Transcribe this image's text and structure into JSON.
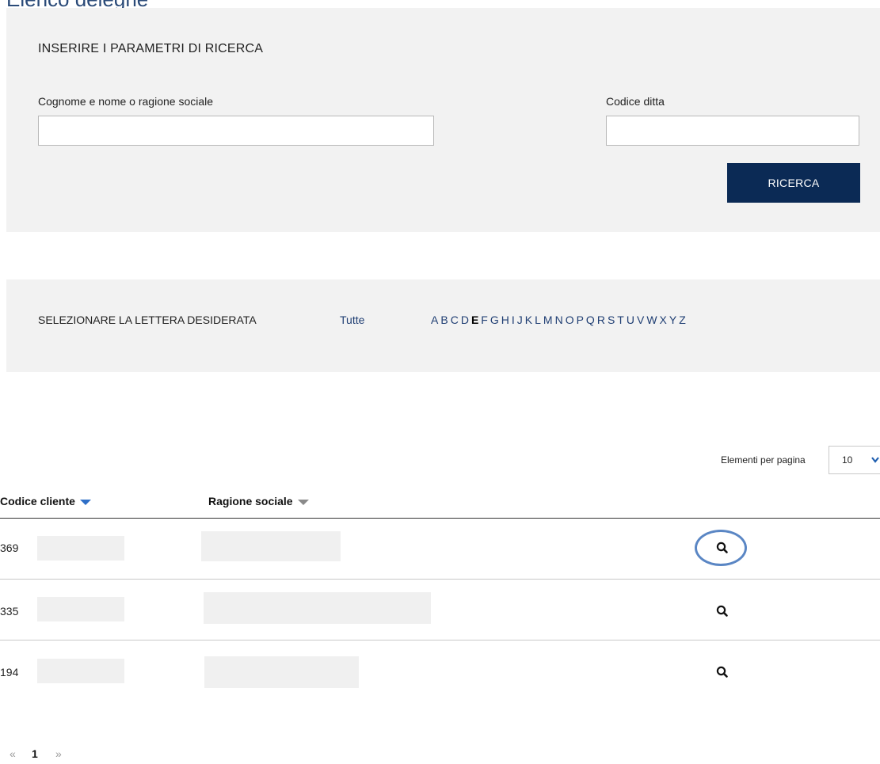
{
  "page": {
    "title": "Elenco deleghe"
  },
  "search": {
    "heading": "INSERIRE I PARAMETRI DI RICERCA",
    "name_label": "Cognome e nome o ragione sociale",
    "name_value": "",
    "code_label": "Codice ditta",
    "code_value": "",
    "button_label": "RICERCA"
  },
  "letter_filter": {
    "label": "SELEZIONARE LA LETTERA DESIDERATA",
    "all_label": "Tutte",
    "letters": [
      "A",
      "B",
      "C",
      "D",
      "E",
      "F",
      "G",
      "H",
      "I",
      "J",
      "K",
      "L",
      "M",
      "N",
      "O",
      "P",
      "Q",
      "R",
      "S",
      "T",
      "U",
      "V",
      "W",
      "X",
      "Y",
      "Z"
    ],
    "active_letter": "E"
  },
  "page_size": {
    "label": "Elementi per pagina",
    "value": "10"
  },
  "table": {
    "columns": [
      {
        "label": "Codice cliente",
        "sort": "active-desc"
      },
      {
        "label": "Ragione sociale",
        "sort": "inactive"
      }
    ],
    "rows": [
      {
        "code": "369"
      },
      {
        "code": "335"
      },
      {
        "code": "194"
      }
    ]
  },
  "pagination": {
    "prev": "«",
    "current": "1",
    "next": "»"
  },
  "colors": {
    "primary_button": "#0b2a55",
    "link": "#1f3e73",
    "panel_bg": "#f2f2f2",
    "sort_active": "#2f6fc7",
    "highlight_ring": "#5a86c4"
  }
}
